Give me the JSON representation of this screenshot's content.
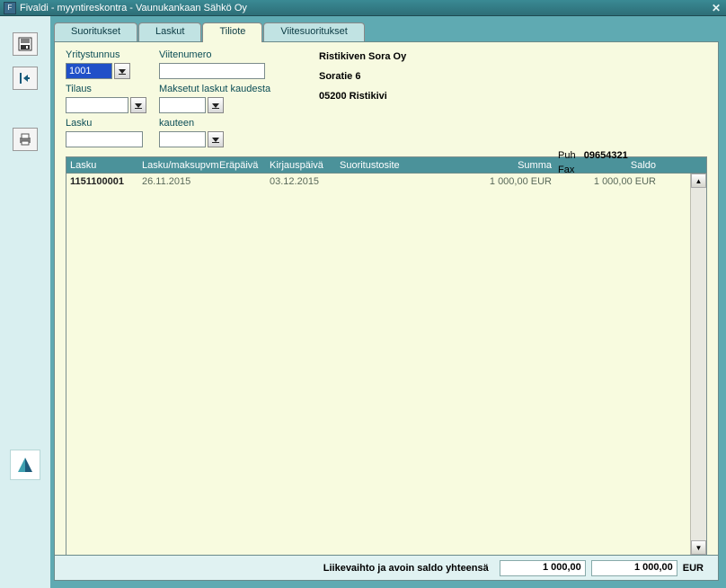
{
  "window": {
    "title": "Fivaldi - myyntireskontra - Vaunukankaan Sähkö Oy"
  },
  "tabs": {
    "suoritukset": "Suoritukset",
    "laskut": "Laskut",
    "tiliote": "Tiliote",
    "viitesuoritukset": "Viitesuoritukset"
  },
  "form": {
    "yritystunnus_label": "Yritystunnus",
    "yritystunnus_value": "1001",
    "tilaus_label": "Tilaus",
    "tilaus_value": "",
    "lasku_label": "Lasku",
    "lasku_value": "",
    "viitenumero_label": "Viitenumero",
    "viitenumero_value": "",
    "maksetut_label": "Maksetut laskut kaudesta",
    "maksetut_value": "",
    "kauteen_label": "kauteen",
    "kauteen_value": ""
  },
  "company": {
    "name": "Ristikiven Sora Oy",
    "street": "Soratie 6",
    "postal": "05200 Ristikivi",
    "puh_label": "Puh",
    "puh": "09654321",
    "fax_label": "Fax",
    "fax": ""
  },
  "grid": {
    "headers": {
      "lasku": "Lasku",
      "maksupvm": "Lasku/maksupvm",
      "erapaiva": "Eräpäivä",
      "kirjauspaiva": "Kirjauspäivä",
      "suoritustosite": "Suoritustosite",
      "summa": "Summa",
      "saldo": "Saldo"
    },
    "rows": [
      {
        "lasku": "1151100001",
        "maksupvm": "26.11.2015",
        "erapaiva": "",
        "kirjauspaiva": "03.12.2015",
        "suoritustosite": "",
        "summa": "1 000,00  EUR",
        "saldo": "1 000,00  EUR"
      }
    ]
  },
  "totals": {
    "label": "Liikevaihto ja avoin saldo yhteensä",
    "liikevaihto": "1 000,00",
    "saldo": "1 000,00",
    "currency": "EUR"
  }
}
